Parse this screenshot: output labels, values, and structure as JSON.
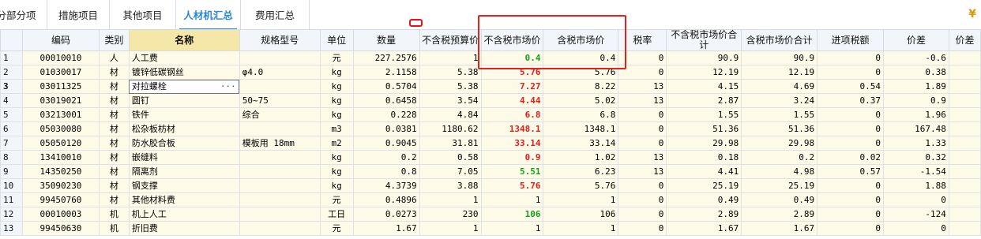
{
  "tabs": [
    {
      "label": "分部分项",
      "active": false
    },
    {
      "label": "措施项目",
      "active": false
    },
    {
      "label": "其他项目",
      "active": false
    },
    {
      "label": "人材机汇总",
      "active": true
    },
    {
      "label": "费用汇总",
      "active": false
    }
  ],
  "top_right_icon": "yen-icon",
  "table": {
    "headers": [
      "",
      "编码",
      "类别",
      "名称",
      "规格型号",
      "单位",
      "数量",
      "不含税预算价",
      "不含税市场价",
      "含税市场价",
      "税率",
      "不含税市场价合计",
      "含税市场价合计",
      "进项税额",
      "价差",
      "价差"
    ],
    "rows": [
      {
        "no": "1",
        "code": "00010010",
        "cat": "人",
        "name": "人工费",
        "spec": "",
        "unit": "元",
        "qty": "227.2576",
        "budget": "1",
        "mkt": "0.4",
        "mkt_color": "green",
        "mkt_tax": "0.4",
        "rate": "0",
        "mkt_total": "90.9",
        "mkt_tax_total": "90.9",
        "input_tax": "0",
        "diff": "-0.6"
      },
      {
        "no": "2",
        "code": "01030017",
        "cat": "材",
        "name": "镀锌低碳钢丝",
        "spec": "φ4.0",
        "unit": "kg",
        "qty": "2.1158",
        "budget": "5.38",
        "mkt": "5.76",
        "mkt_color": "red",
        "mkt_tax": "5.76",
        "rate": "0",
        "mkt_total": "12.19",
        "mkt_tax_total": "12.19",
        "input_tax": "0",
        "diff": "0.38"
      },
      {
        "no": "3",
        "code": "03011325",
        "cat": "材",
        "name": "对拉螺栓",
        "spec": "",
        "unit": "kg",
        "qty": "0.5704",
        "budget": "5.38",
        "mkt": "7.27",
        "mkt_color": "red",
        "mkt_tax": "8.22",
        "rate": "13",
        "mkt_total": "4.15",
        "mkt_tax_total": "4.69",
        "input_tax": "0.54",
        "diff": "1.89"
      },
      {
        "no": "4",
        "code": "03019021",
        "cat": "材",
        "name": "圆钉",
        "spec": "50~75",
        "unit": "kg",
        "qty": "0.6458",
        "budget": "3.54",
        "mkt": "4.44",
        "mkt_color": "red",
        "mkt_tax": "5.02",
        "rate": "13",
        "mkt_total": "2.87",
        "mkt_tax_total": "3.24",
        "input_tax": "0.37",
        "diff": "0.9"
      },
      {
        "no": "5",
        "code": "03213001",
        "cat": "材",
        "name": "铁件",
        "spec": "综合",
        "unit": "kg",
        "qty": "0.228",
        "budget": "4.84",
        "mkt": "6.8",
        "mkt_color": "red",
        "mkt_tax": "6.8",
        "rate": "0",
        "mkt_total": "1.55",
        "mkt_tax_total": "1.55",
        "input_tax": "0",
        "diff": "1.96"
      },
      {
        "no": "6",
        "code": "05030080",
        "cat": "材",
        "name": "松杂板枋材",
        "spec": "",
        "unit": "m3",
        "qty": "0.0381",
        "budget": "1180.62",
        "mkt": "1348.1",
        "mkt_color": "red",
        "mkt_tax": "1348.1",
        "rate": "0",
        "mkt_total": "51.36",
        "mkt_tax_total": "51.36",
        "input_tax": "0",
        "diff": "167.48"
      },
      {
        "no": "7",
        "code": "05050120",
        "cat": "材",
        "name": "防水胶合板",
        "spec": "模板用 18mm",
        "unit": "m2",
        "qty": "0.9045",
        "budget": "31.81",
        "mkt": "33.14",
        "mkt_color": "red",
        "mkt_tax": "33.14",
        "rate": "0",
        "mkt_total": "29.98",
        "mkt_tax_total": "29.98",
        "input_tax": "0",
        "diff": "1.33"
      },
      {
        "no": "8",
        "code": "13410010",
        "cat": "材",
        "name": "嵌缝料",
        "spec": "",
        "unit": "kg",
        "qty": "0.2",
        "budget": "0.58",
        "mkt": "0.9",
        "mkt_color": "red",
        "mkt_tax": "1.02",
        "rate": "13",
        "mkt_total": "0.18",
        "mkt_tax_total": "0.2",
        "input_tax": "0.02",
        "diff": "0.32"
      },
      {
        "no": "9",
        "code": "14350250",
        "cat": "材",
        "name": "隔离剂",
        "spec": "",
        "unit": "kg",
        "qty": "0.8",
        "budget": "7.05",
        "mkt": "5.51",
        "mkt_color": "green",
        "mkt_tax": "6.23",
        "rate": "13",
        "mkt_total": "4.41",
        "mkt_tax_total": "4.98",
        "input_tax": "0.57",
        "diff": "-1.54"
      },
      {
        "no": "10",
        "code": "35090230",
        "cat": "材",
        "name": "钢支撑",
        "spec": "",
        "unit": "kg",
        "qty": "4.3739",
        "budget": "3.88",
        "mkt": "5.76",
        "mkt_color": "red",
        "mkt_tax": "5.76",
        "rate": "0",
        "mkt_total": "25.19",
        "mkt_tax_total": "25.19",
        "input_tax": "0",
        "diff": "1.88"
      },
      {
        "no": "11",
        "code": "99450760",
        "cat": "材",
        "name": "其他材料费",
        "spec": "",
        "unit": "元",
        "qty": "0.4896",
        "budget": "1",
        "mkt": "1",
        "mkt_color": "plain",
        "mkt_tax": "1",
        "rate": "0",
        "mkt_total": "0.49",
        "mkt_tax_total": "0.49",
        "input_tax": "0",
        "diff": "0"
      },
      {
        "no": "12",
        "code": "00010003",
        "cat": "机",
        "name": "机上人工",
        "spec": "",
        "unit": "工日",
        "qty": "0.0273",
        "budget": "230",
        "mkt": "106",
        "mkt_color": "green",
        "mkt_tax": "106",
        "rate": "0",
        "mkt_total": "2.89",
        "mkt_tax_total": "2.89",
        "input_tax": "0",
        "diff": "-124"
      },
      {
        "no": "13",
        "code": "99450630",
        "cat": "机",
        "name": "折旧费",
        "spec": "",
        "unit": "元",
        "qty": "1.67",
        "budget": "1",
        "mkt": "1",
        "mkt_color": "plain",
        "mkt_tax": "1",
        "rate": "0",
        "mkt_total": "1.67",
        "mkt_tax_total": "1.67",
        "input_tax": "0",
        "diff": "0"
      }
    ]
  },
  "colors": {
    "accent": "#2a86d6",
    "highlight_box": "#e0241c",
    "price_up": "#e61c1c",
    "price_down": "#18a018",
    "row_bg": "#fdfbe8",
    "name_header_bg": "#f5e7a8"
  }
}
